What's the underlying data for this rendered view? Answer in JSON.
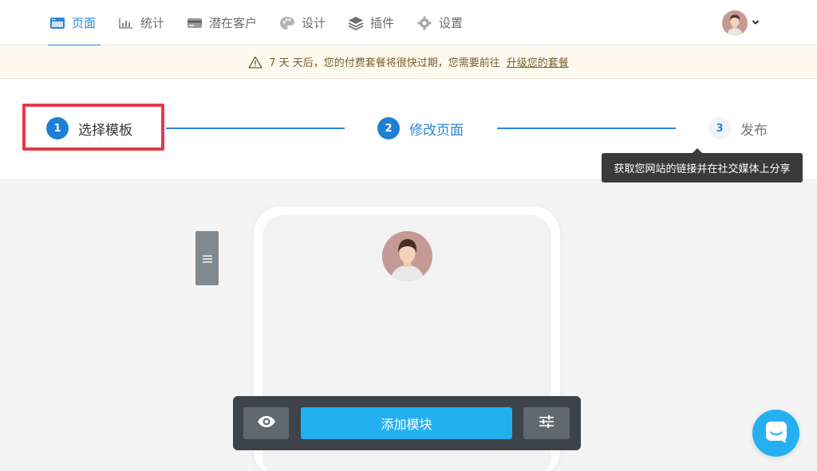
{
  "nav": {
    "items": [
      {
        "label": "页面",
        "icon": "browser-window-icon",
        "active": true
      },
      {
        "label": "统计",
        "icon": "bar-chart-icon",
        "active": false
      },
      {
        "label": "潜在客户",
        "icon": "credit-card-icon",
        "active": false
      },
      {
        "label": "设计",
        "icon": "palette-icon",
        "active": false
      },
      {
        "label": "插件",
        "icon": "layers-icon",
        "active": false
      },
      {
        "label": "设置",
        "icon": "gear-icon",
        "active": false
      }
    ]
  },
  "banner": {
    "text": "7 天 天后，您的付费套餐将很快过期，您需要前往",
    "link": "升级您的套餐"
  },
  "steps": [
    {
      "num": "1",
      "label": "选择模板"
    },
    {
      "num": "2",
      "label": "修改页面"
    },
    {
      "num": "3",
      "label": "发布"
    }
  ],
  "tooltip": "获取您网站的链接并在社交媒体上分享",
  "toolbar": {
    "add_label": "添加模块"
  },
  "colors": {
    "accent": "#2a86d8",
    "primary_button": "#22b0f0",
    "highlight": "#e8384a",
    "banner_bg": "#fdf9ef"
  }
}
